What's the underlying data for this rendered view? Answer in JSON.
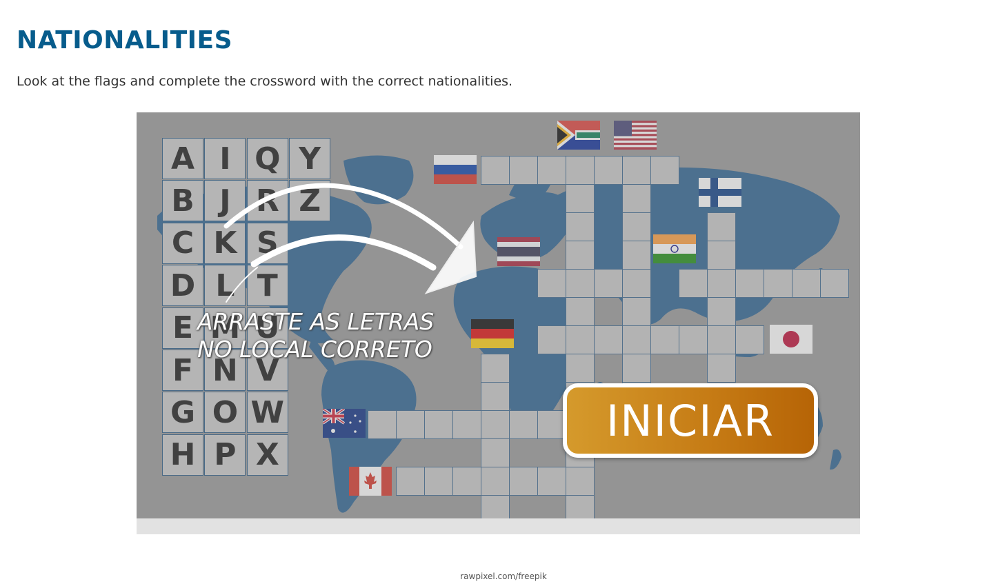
{
  "page": {
    "title": "NATIONALITIES",
    "instructions": "Look at the flags and complete the crossword with the correct nationalities.",
    "credit": "rawpixel.com/freepik"
  },
  "game": {
    "letter_tiles": [
      [
        "A",
        "I",
        "Q",
        "Y"
      ],
      [
        "B",
        "J",
        "R",
        "Z"
      ],
      [
        "C",
        "K",
        "S"
      ],
      [
        "D",
        "L",
        "T"
      ],
      [
        "E",
        "M",
        "U"
      ],
      [
        "F",
        "N",
        "V"
      ],
      [
        "G",
        "O",
        "W"
      ],
      [
        "H",
        "P",
        "X"
      ]
    ],
    "flags": [
      "south-africa-flag",
      "usa-flag",
      "russia-flag",
      "finland-flag",
      "thailand-flag",
      "india-flag",
      "germany-flag",
      "japan-flag",
      "australia-flag",
      "canada-flag"
    ],
    "drag_hint_line1": "ARRASTE AS LETRAS",
    "drag_hint_line2": "NO LOCAL CORRETO",
    "start_button_label": "INICIAR"
  },
  "colors": {
    "title": "#075c8c",
    "stage_background": "#939393",
    "map_ocean_land": "#1f5a8c",
    "cell_border": "#2c5b86",
    "start_button": "#c57a14"
  }
}
